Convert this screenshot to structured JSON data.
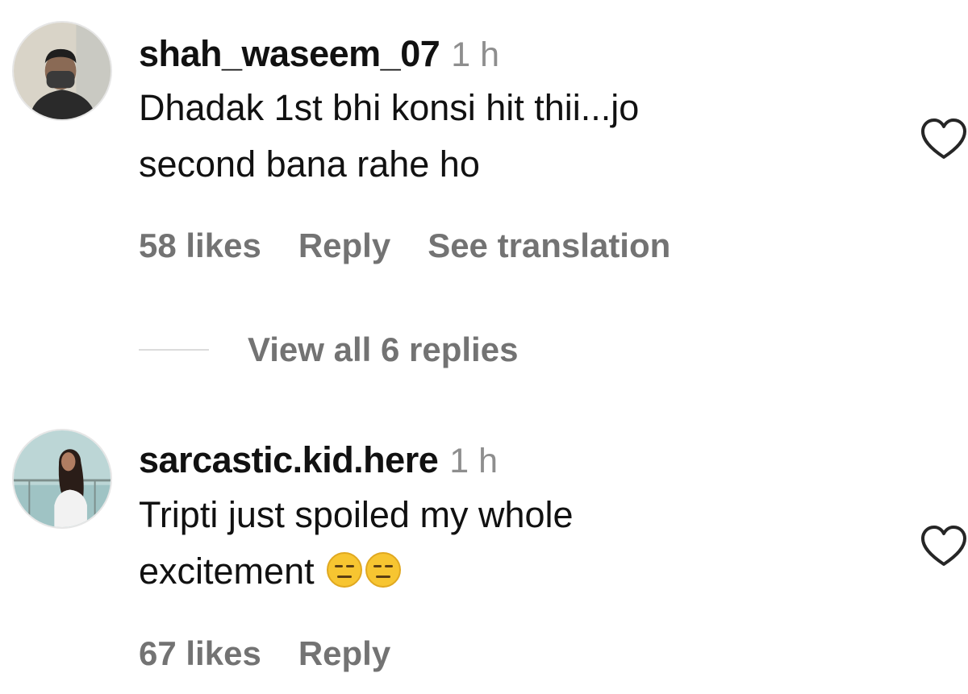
{
  "comments": [
    {
      "username": "shah_waseem_07",
      "time": "1 h",
      "text_line1": "Dhadak 1st bhi konsi hit thii...jo",
      "text_line2": "second bana rahe ho",
      "likes": "58 likes",
      "reply": "Reply",
      "translate": "See translation",
      "view_replies": "View all 6 replies"
    },
    {
      "username": "sarcastic.kid.here",
      "time": "1 h",
      "text_line1": "Tripti just spoiled my whole",
      "text_line2": "excitement",
      "emojis": "😑😑",
      "likes": "67 likes",
      "reply": "Reply"
    }
  ],
  "icons": {
    "like": "heart-outline-icon",
    "emoji": "expressionless-face-emoji"
  },
  "colors": {
    "primary_text": "#111111",
    "secondary_text": "#737373",
    "timestamp": "#8e8e8e",
    "divider": "#dbdbdb",
    "emoji_fill": "#f7c531"
  }
}
